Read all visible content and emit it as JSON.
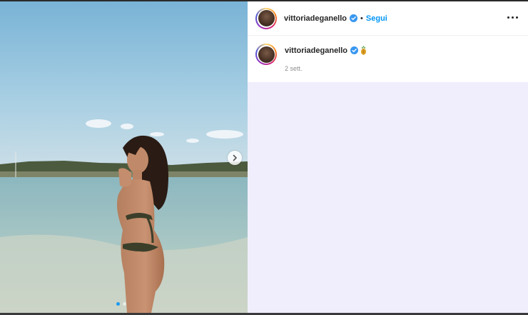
{
  "post": {
    "username": "vittoriadeganello",
    "separator": "•",
    "follow_label": "Segui",
    "timestamp": "2 sett."
  },
  "carousel": {
    "dot_count": 2,
    "active_index": 0
  },
  "icons": {
    "verified": "verified-badge-icon",
    "more": "more-options-icon",
    "next": "chevron-right-icon",
    "caption_emoji": "pineapple-emoji"
  },
  "colors": {
    "follow": "#0095f6",
    "verified": "#3897f0",
    "panel_bg": "#f0eefc"
  }
}
